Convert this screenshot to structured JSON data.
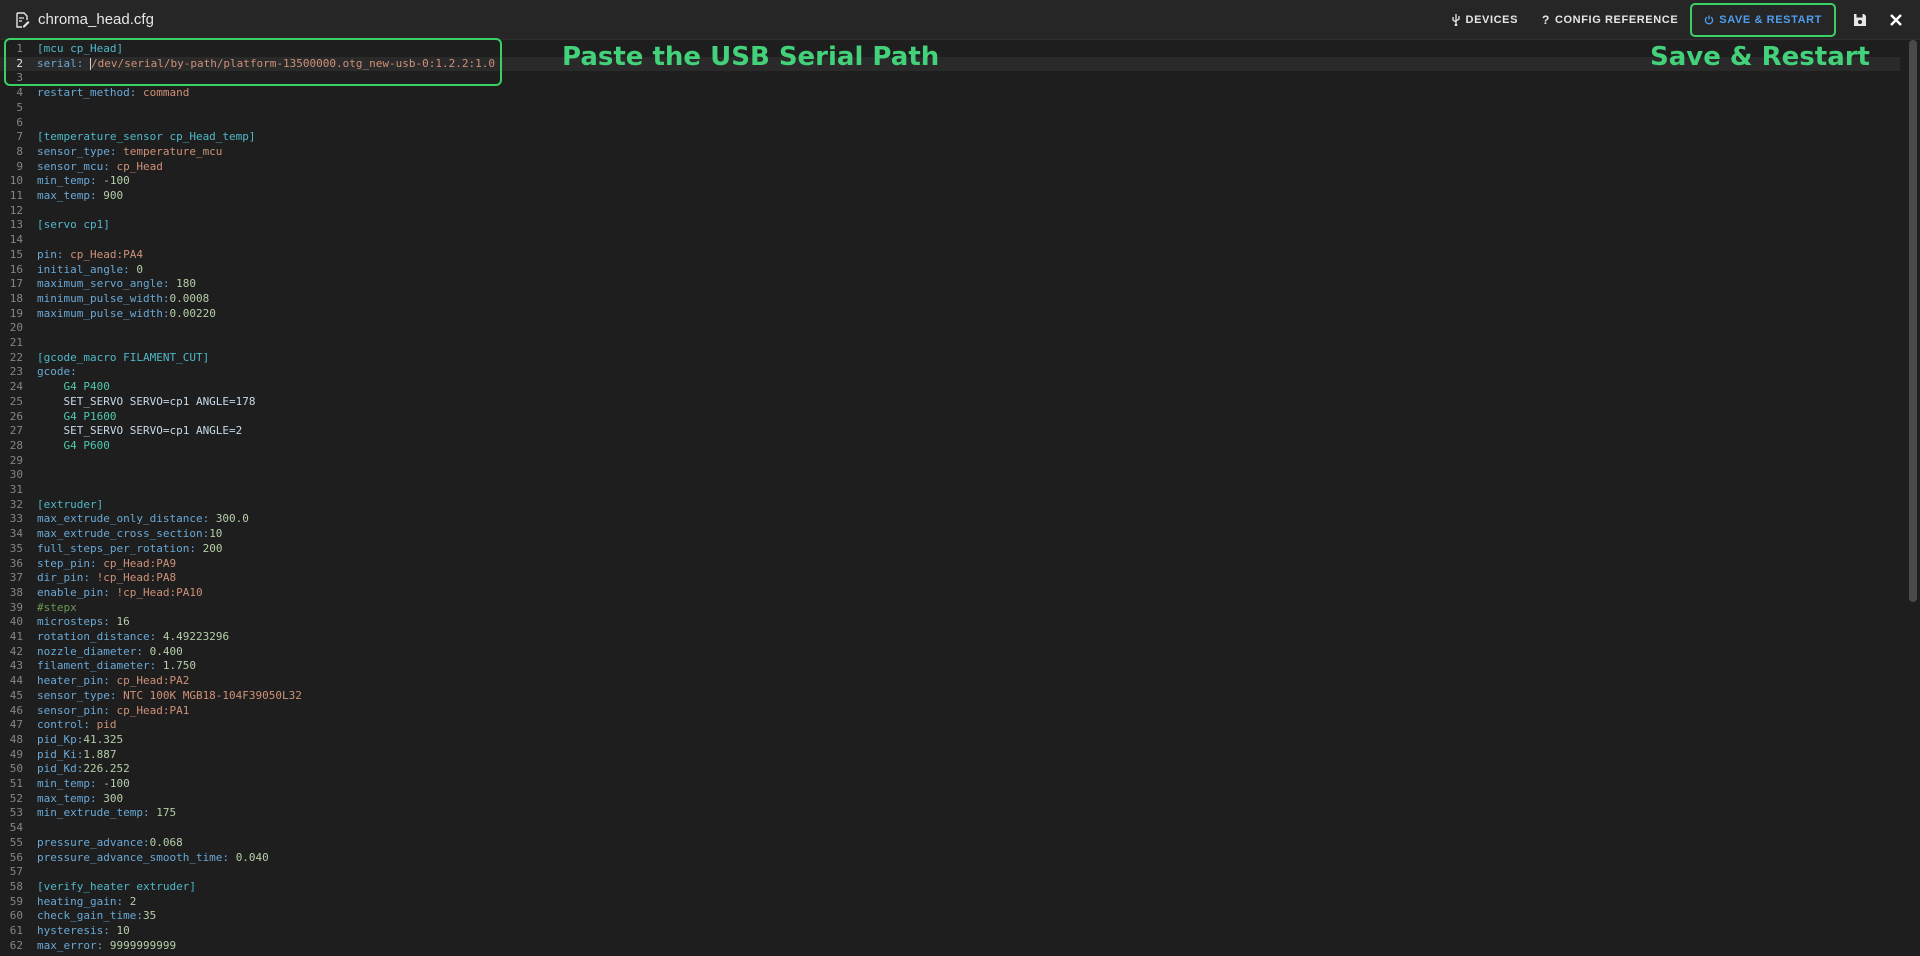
{
  "header": {
    "title": "chroma_head.cfg",
    "devices_label": "DEVICES",
    "config_reference_label": "CONFIG REFERENCE",
    "save_restart_label": "SAVE & RESTART"
  },
  "annotations": {
    "left": "Paste the USB Serial Path",
    "right": "Save & Restart"
  },
  "editor": {
    "active_line": 2,
    "lines": [
      [
        [
          "[mcu cp_Head]",
          "sec"
        ]
      ],
      [
        [
          "serial: ",
          "k"
        ],
        [
          "/dev/serial/by-path/platform-13500000.otg_new-usb-0:1.2.2:1.0",
          "v"
        ]
      ],
      [],
      [
        [
          "restart_method: ",
          "k"
        ],
        [
          "command",
          "v"
        ]
      ],
      [],
      [],
      [
        [
          "[temperature_sensor cp_Head_temp]",
          "sec"
        ]
      ],
      [
        [
          "sensor_type: ",
          "k"
        ],
        [
          "temperature_mcu",
          "v"
        ]
      ],
      [
        [
          "sensor_mcu: ",
          "k"
        ],
        [
          "cp_Head",
          "v"
        ]
      ],
      [
        [
          "min_temp: ",
          "k"
        ],
        [
          "-100",
          "n"
        ]
      ],
      [
        [
          "max_temp: ",
          "k"
        ],
        [
          "900",
          "n"
        ]
      ],
      [],
      [
        [
          "[servo cp1]",
          "sec"
        ]
      ],
      [],
      [
        [
          "pin: ",
          "k"
        ],
        [
          "cp_Head:PA4",
          "v"
        ]
      ],
      [
        [
          "initial_angle: ",
          "k"
        ],
        [
          "0",
          "n"
        ]
      ],
      [
        [
          "maximum_servo_angle: ",
          "k"
        ],
        [
          "180",
          "n"
        ]
      ],
      [
        [
          "minimum_pulse_width:",
          "k"
        ],
        [
          "0.0008",
          "n"
        ]
      ],
      [
        [
          "maximum_pulse_width:",
          "k"
        ],
        [
          "0.00220",
          "n"
        ]
      ],
      [],
      [],
      [
        [
          "[gcode_macro FILAMENT_CUT]",
          "sec"
        ]
      ],
      [
        [
          "gcode:",
          "k"
        ]
      ],
      [
        [
          "    G4 P400",
          "s"
        ]
      ],
      [
        [
          "    SET_SERVO SERVO=cp1 ANGLE=178",
          "g"
        ]
      ],
      [
        [
          "    G4 P1600",
          "s"
        ]
      ],
      [
        [
          "    SET_SERVO SERVO=cp1 ANGLE=2",
          "g"
        ]
      ],
      [
        [
          "    G4 P600",
          "s"
        ]
      ],
      [],
      [],
      [],
      [
        [
          "[extruder]",
          "sec"
        ]
      ],
      [
        [
          "max_extrude_only_distance: ",
          "k"
        ],
        [
          "300.0",
          "n"
        ]
      ],
      [
        [
          "max_extrude_cross_section:",
          "k"
        ],
        [
          "10",
          "n"
        ]
      ],
      [
        [
          "full_steps_per_rotation: ",
          "k"
        ],
        [
          "200",
          "n"
        ]
      ],
      [
        [
          "step_pin: ",
          "k"
        ],
        [
          "cp_Head:PA9",
          "v"
        ]
      ],
      [
        [
          "dir_pin: ",
          "k"
        ],
        [
          "!cp_Head:PA8",
          "v"
        ]
      ],
      [
        [
          "enable_pin: ",
          "k"
        ],
        [
          "!cp_Head:PA10",
          "v"
        ]
      ],
      [
        [
          "#stepx",
          "c"
        ]
      ],
      [
        [
          "microsteps: ",
          "k"
        ],
        [
          "16",
          "n"
        ]
      ],
      [
        [
          "rotation_distance: ",
          "k"
        ],
        [
          "4.49223296",
          "n"
        ]
      ],
      [
        [
          "nozzle_diameter: ",
          "k"
        ],
        [
          "0.400",
          "n"
        ]
      ],
      [
        [
          "filament_diameter: ",
          "k"
        ],
        [
          "1.750",
          "n"
        ]
      ],
      [
        [
          "heater_pin: ",
          "k"
        ],
        [
          "cp_Head:PA2",
          "v"
        ]
      ],
      [
        [
          "sensor_type: ",
          "k"
        ],
        [
          "NTC 100K MGB18-104F39050L32",
          "v"
        ]
      ],
      [
        [
          "sensor_pin: ",
          "k"
        ],
        [
          "cp_Head:PA1",
          "v"
        ]
      ],
      [
        [
          "control: ",
          "k"
        ],
        [
          "pid",
          "v"
        ]
      ],
      [
        [
          "pid_Kp:",
          "k"
        ],
        [
          "41.325",
          "n"
        ]
      ],
      [
        [
          "pid_Ki:",
          "k"
        ],
        [
          "1.887",
          "n"
        ]
      ],
      [
        [
          "pid_Kd:",
          "k"
        ],
        [
          "226.252",
          "n"
        ]
      ],
      [
        [
          "min_temp: ",
          "k"
        ],
        [
          "-100",
          "n"
        ]
      ],
      [
        [
          "max_temp: ",
          "k"
        ],
        [
          "300",
          "n"
        ]
      ],
      [
        [
          "min_extrude_temp: ",
          "k"
        ],
        [
          "175",
          "n"
        ]
      ],
      [],
      [
        [
          "pressure_advance:",
          "k"
        ],
        [
          "0.068",
          "n"
        ]
      ],
      [
        [
          "pressure_advance_smooth_time: ",
          "k"
        ],
        [
          "0.040",
          "n"
        ]
      ],
      [],
      [
        [
          "[verify_heater extruder]",
          "sec"
        ]
      ],
      [
        [
          "heating_gain: ",
          "k"
        ],
        [
          "2",
          "n"
        ]
      ],
      [
        [
          "check_gain_time:",
          "k"
        ],
        [
          "35",
          "n"
        ]
      ],
      [
        [
          "hysteresis: ",
          "k"
        ],
        [
          "10",
          "n"
        ]
      ],
      [
        [
          "max_error: ",
          "k"
        ],
        [
          "9999999999",
          "n"
        ]
      ]
    ]
  }
}
